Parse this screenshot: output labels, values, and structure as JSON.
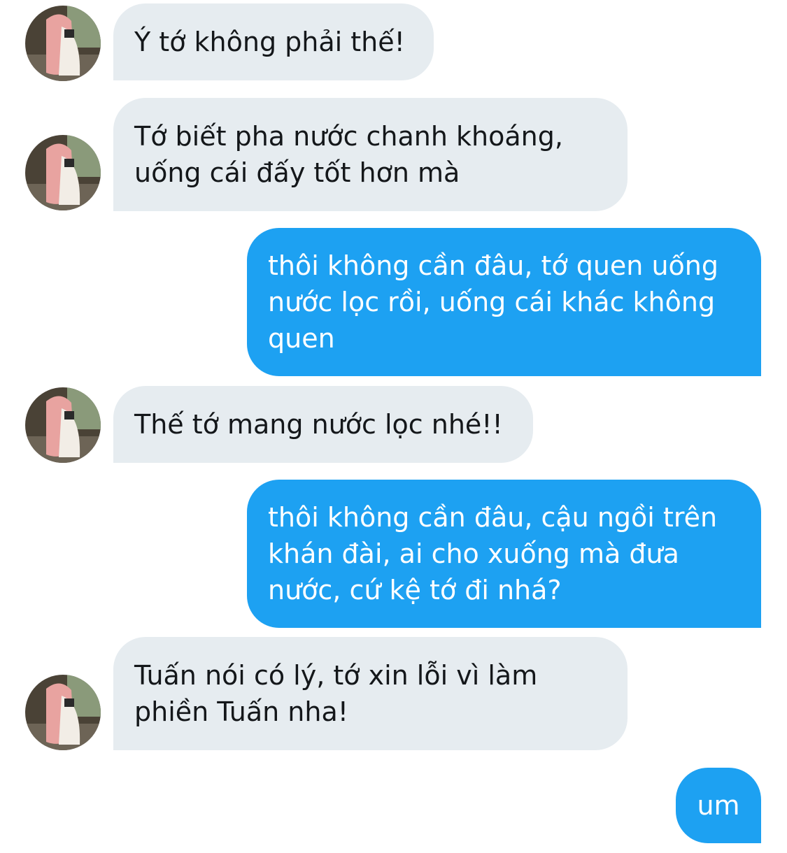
{
  "colors": {
    "incoming_bubble": "#e6ecf0",
    "incoming_text": "#14171a",
    "outgoing_bubble": "#1da1f2",
    "outgoing_text": "#ffffff"
  },
  "avatar_icon": "profile-photo-pink-hair",
  "messages": [
    {
      "sender": "them",
      "text": "Ý tớ không phải thế!"
    },
    {
      "sender": "them",
      "text": "Tớ biết pha nước chanh khoáng,\nuống cái đấy tốt hơn mà"
    },
    {
      "sender": "me",
      "text": "thôi không cần đâu, tớ quen uống\nnước lọc rồi, uống cái khác không\nquen"
    },
    {
      "sender": "them",
      "text": "Thế tớ mang nước lọc nhé!!"
    },
    {
      "sender": "me",
      "text": "thôi không cần đâu, cậu ngồi trên\nkhán đài, ai cho xuống mà đưa\nnước, cứ kệ tớ đi nhá?"
    },
    {
      "sender": "them",
      "text": "Tuấn nói có lý, tớ xin lỗi vì làm\nphiền Tuấn nha!"
    },
    {
      "sender": "me",
      "text": "um"
    }
  ]
}
